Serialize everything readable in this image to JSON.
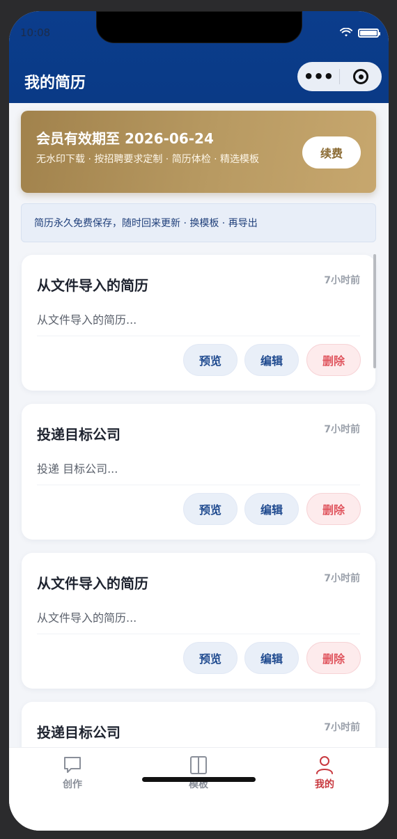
{
  "status_bar": {
    "time": "10:08"
  },
  "nav": {
    "title": "我的简历",
    "menu_glyph": "•••"
  },
  "member": {
    "title": "会员有效期至 2026-06-24",
    "perks": "无水印下载 · 按招聘要求定制 · 简历体检 · 精选模板",
    "renew_label": "续费"
  },
  "notice": {
    "text": "简历永久免费保存，随时回来更新 · 换模板 · 再导出"
  },
  "resumes": [
    {
      "title": "从文件导入的简历",
      "time": "7小时前",
      "desc": "从文件导入的简历..."
    },
    {
      "title": "投递目标公司",
      "time": "7小时前",
      "desc": "投递 目标公司..."
    },
    {
      "title": "从文件导入的简历",
      "time": "7小时前",
      "desc": "从文件导入的简历..."
    },
    {
      "title": "投递目标公司",
      "time": "7小时前",
      "desc": ""
    }
  ],
  "actions": {
    "preview": "预览",
    "edit": "编辑",
    "delete": "删除"
  },
  "tabbar": {
    "items": [
      {
        "label": "创作",
        "icon": "chat-bubble-icon"
      },
      {
        "label": "模板",
        "icon": "template-icon"
      },
      {
        "label": "我的",
        "icon": "user-icon",
        "active": true
      }
    ]
  },
  "colors": {
    "nav_bg": "#0b3d8c",
    "gold": "#b89a62",
    "accent_red": "#c8383e",
    "primary_blue": "#1f4a8f"
  }
}
